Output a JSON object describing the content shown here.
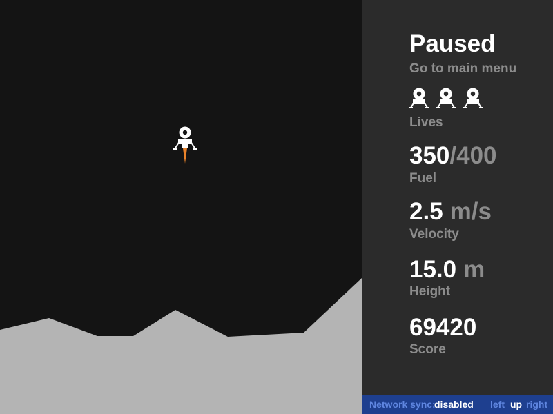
{
  "game": {
    "terrain_color": "#b4b4b4",
    "sky_color": "#141414",
    "flame_color": "#e8822a",
    "lander_icon": "lunar-lander-icon"
  },
  "panel": {
    "title": "Paused",
    "menu_link": "Go to main menu",
    "lives": {
      "count": 3,
      "icon": "lander-icon",
      "label": "Lives"
    },
    "fuel": {
      "current": "350",
      "max": "/400",
      "label": "Fuel"
    },
    "velocity": {
      "value": "2.5",
      "unit": "m/s",
      "label": "Velocity"
    },
    "height": {
      "value": "15.0",
      "unit": "m",
      "label": "Height"
    },
    "score": {
      "value": "69420",
      "label": "Score"
    }
  },
  "footer": {
    "network_label": "Network sync:",
    "network_value": "disabled",
    "keys": {
      "left": "left",
      "up": "up",
      "right": "right"
    },
    "background": "#1e3f8f"
  }
}
